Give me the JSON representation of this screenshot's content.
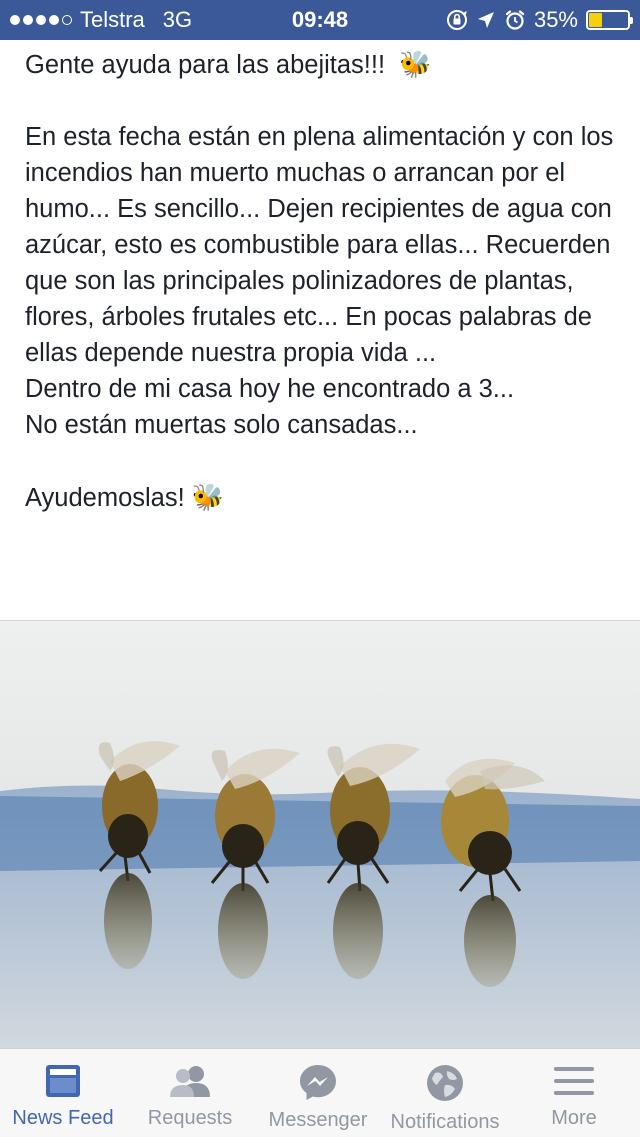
{
  "status_bar": {
    "carrier": "Telstra",
    "network": "3G",
    "time": "09:48",
    "battery_text": "35%",
    "battery_level": 0.35,
    "signal_bars_filled": 4,
    "signal_bars_total": 5,
    "icons": [
      "orientation-lock-icon",
      "location-arrow-icon",
      "alarm-icon",
      "battery-icon"
    ]
  },
  "post": {
    "line1": "Gente ayuda para las abejitas!!!",
    "paragraph": "En esta fecha están en plena alimentación y con los incendios han muerto muchas o arrancan por el humo... Es sencillo... Dejen recipientes de agua con azúcar, esto es combustible para ellas... Recuerden que son las principales polinizadores de plantas, flores, árboles frutales etc... En pocas palabras de ellas depende nuestra propia vida ...",
    "line3": "Dentro de mi casa hoy he encontrado a 3...",
    "line4": "No están muertas solo cansadas...",
    "closing": "Ayudemoslas!",
    "emoji": "🐝"
  },
  "tab_bar": {
    "tabs": [
      {
        "label": "News Feed",
        "icon": "news-feed-icon",
        "active": true
      },
      {
        "label": "Requests",
        "icon": "requests-icon",
        "active": false
      },
      {
        "label": "Messenger",
        "icon": "messenger-icon",
        "active": false
      },
      {
        "label": "Notifications",
        "icon": "globe-icon",
        "active": false
      },
      {
        "label": "More",
        "icon": "menu-icon",
        "active": false
      }
    ]
  },
  "colors": {
    "status_bar_bg": "#3b5998",
    "active_tab": "#4267b2",
    "inactive_tab": "#9197a3",
    "battery_fill": "#f5d10b"
  }
}
